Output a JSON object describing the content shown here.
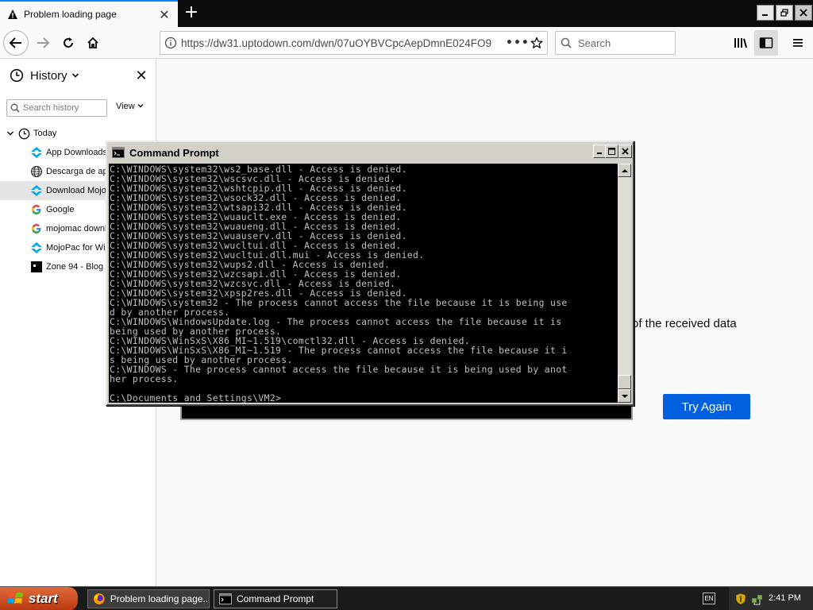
{
  "browser": {
    "tab": {
      "title": "Problem loading page"
    },
    "url": "https://dw31.uptodown.com/dwn/07uOYBVCpcAepDmnE024FO9",
    "search_placeholder": "Search"
  },
  "sidebar": {
    "title": "History",
    "search_placeholder": "Search history",
    "view_label": "View",
    "group_label": "Today",
    "items": [
      {
        "label": "App Downloads",
        "icon": "uptodown-icon"
      },
      {
        "label": "Descarga de ap",
        "icon": "globe-icon"
      },
      {
        "label": "Download Mojo",
        "icon": "uptodown-icon"
      },
      {
        "label": "Google",
        "icon": "google-icon"
      },
      {
        "label": "mojomac downl",
        "icon": "google-icon"
      },
      {
        "label": "MojoPac for Wir",
        "icon": "uptodown-icon"
      },
      {
        "label": "Zone 94 - Blog",
        "icon": "zone94-icon"
      }
    ]
  },
  "content": {
    "partial_text": "of the received data",
    "try_again_label": "Try Again"
  },
  "cmd": {
    "title": "Command Prompt",
    "lines": [
      "C:\\WINDOWS\\system32\\ws2_base.dll - Access is denied.",
      "C:\\WINDOWS\\system32\\wscsvc.dll - Access is denied.",
      "C:\\WINDOWS\\system32\\wshtcpip.dll - Access is denied.",
      "C:\\WINDOWS\\system32\\wsock32.dll - Access is denied.",
      "C:\\WINDOWS\\system32\\wtsapi32.dll - Access is denied.",
      "C:\\WINDOWS\\system32\\wuauclt.exe - Access is denied.",
      "C:\\WINDOWS\\system32\\wuaueng.dll - Access is denied.",
      "C:\\WINDOWS\\system32\\wuauserv.dll - Access is denied.",
      "C:\\WINDOWS\\system32\\wucltui.dll - Access is denied.",
      "C:\\WINDOWS\\system32\\wucltui.dll.mui - Access is denied.",
      "C:\\WINDOWS\\system32\\wups2.dll - Access is denied.",
      "C:\\WINDOWS\\system32\\wzcsapi.dll - Access is denied.",
      "C:\\WINDOWS\\system32\\wzcsvc.dll - Access is denied.",
      "C:\\WINDOWS\\system32\\xpsp2res.dll - Access is denied.",
      "C:\\WINDOWS\\system32 - The process cannot access the file because it is being use",
      "d by another process.",
      "C:\\WINDOWS\\WindowsUpdate.log - The process cannot access the file because it is",
      "being used by another process.",
      "C:\\WINDOWS\\WinSxS\\X86_MI~1.519\\comctl32.dll - Access is denied.",
      "C:\\WINDOWS\\WinSxS\\X86_MI~1.519 - The process cannot access the file because it i",
      "s being used by another process.",
      "C:\\WINDOWS - The process cannot access the file because it is being used by anot",
      "her process.",
      "",
      "C:\\Documents and Settings\\VM2>"
    ]
  },
  "taskbar": {
    "start_label": "start",
    "tasks": [
      {
        "label": "Problem loading page...",
        "icon": "firefox-icon"
      },
      {
        "label": "Command Prompt",
        "icon": "cmd-icon"
      }
    ],
    "lang": "EN",
    "clock": "2:41 PM"
  }
}
